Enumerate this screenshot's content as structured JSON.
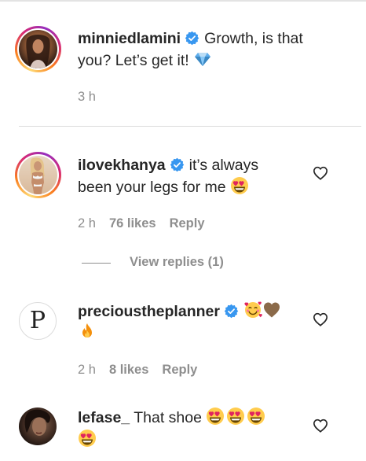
{
  "comments": [
    {
      "username": "minniedlamini",
      "verified": true,
      "text_line1": "Growth, is that",
      "text_line2": "you? Let’s get it!",
      "emoji_end": "gem-icon",
      "time": "3 h",
      "likes": "",
      "reply": "",
      "story_ring": true
    },
    {
      "username": "ilovekhanya",
      "verified": true,
      "text_line1": "it’s always",
      "text_line2": "been your legs for me",
      "emoji_end": "heart-eyes-emoji",
      "time": "2 h",
      "likes": "76 likes",
      "reply": "Reply",
      "view_replies": "View replies (1)",
      "story_ring": true
    },
    {
      "username": "precioustheplanner",
      "verified": true,
      "text_line1": "",
      "text_line2": "",
      "emojis": [
        "smiling-hearts-emoji",
        "brown-heart-emoji",
        "fire-emoji"
      ],
      "avatar_letter": "P",
      "time": "2 h",
      "likes": "8 likes",
      "reply": "Reply",
      "story_ring": false
    },
    {
      "username": "lefase_",
      "verified": false,
      "text_line1": "That shoe",
      "emojis": [
        "heart-eyes-emoji",
        "heart-eyes-emoji",
        "heart-eyes-emoji",
        "heart-eyes-emoji"
      ],
      "story_ring": false
    }
  ],
  "colors": {
    "verified_blue": "#3897f0",
    "muted": "#8e8e8e",
    "text": "#262626"
  }
}
